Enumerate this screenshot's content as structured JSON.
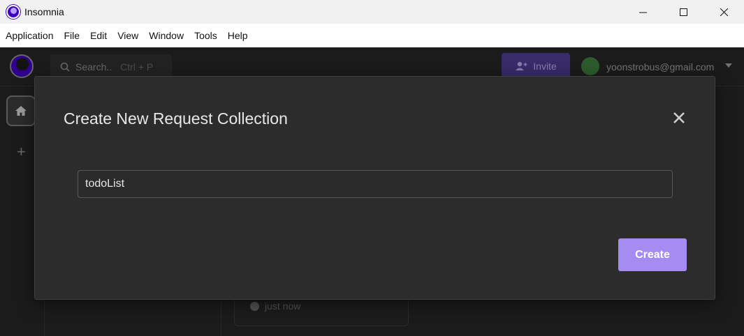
{
  "window": {
    "title": "Insomnia"
  },
  "menu": [
    "Application",
    "File",
    "Edit",
    "View",
    "Window",
    "Tools",
    "Help"
  ],
  "topbar": {
    "search_placeholder": "Search..",
    "search_shortcut": "Ctrl + P",
    "invite_label": "Invite",
    "user_email": "yoonstrobus@gmail.com"
  },
  "card": {
    "time": "just now"
  },
  "modal": {
    "title": "Create New Request Collection",
    "name_value": "todoList",
    "create_label": "Create"
  },
  "colors": {
    "accent": "#a68cf0",
    "brand": "#4000bf",
    "modal_bg": "#2c2c2c"
  }
}
